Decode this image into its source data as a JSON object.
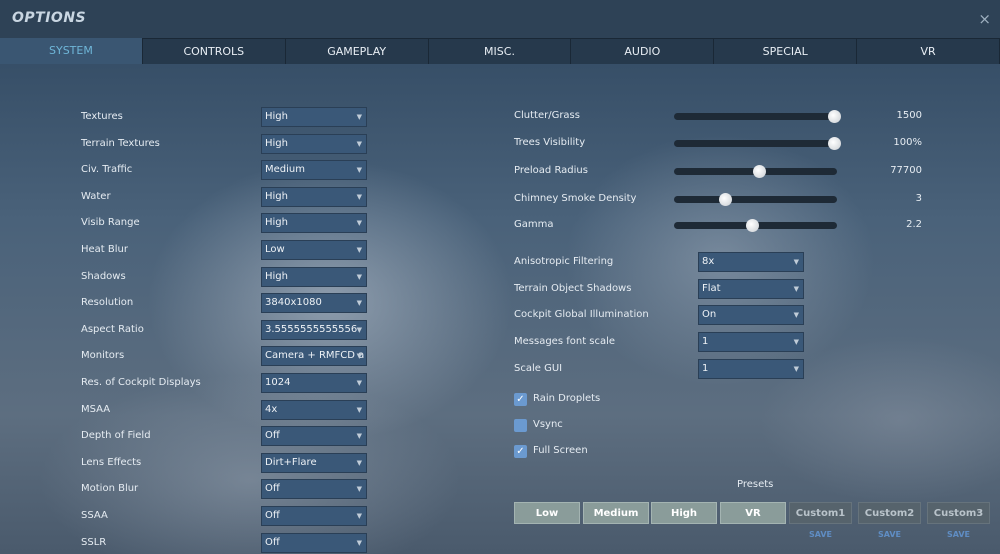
{
  "window": {
    "title": "OPTIONS",
    "close_icon": "×"
  },
  "tabs": [
    "SYSTEM",
    "CONTROLS",
    "GAMEPLAY",
    "MISC.",
    "AUDIO",
    "SPECIAL",
    "VR"
  ],
  "left_settings": [
    {
      "label": "Textures",
      "value": "High"
    },
    {
      "label": "Terrain Textures",
      "value": "High"
    },
    {
      "label": "Civ. Traffic",
      "value": "Medium"
    },
    {
      "label": "Water",
      "value": "High"
    },
    {
      "label": "Visib Range",
      "value": "High"
    },
    {
      "label": "Heat Blur",
      "value": "Low"
    },
    {
      "label": "Shadows",
      "value": "High"
    },
    {
      "label": "Resolution",
      "value": "3840x1080"
    },
    {
      "label": "Aspect Ratio",
      "value": "3.5555555555556"
    },
    {
      "label": "Monitors",
      "value": "Camera + RMFCD a"
    },
    {
      "label": "Res. of Cockpit Displays",
      "value": "1024"
    },
    {
      "label": "MSAA",
      "value": "4x"
    },
    {
      "label": "Depth of Field",
      "value": "Off"
    },
    {
      "label": "Lens Effects",
      "value": "Dirt+Flare"
    },
    {
      "label": "Motion Blur",
      "value": "Off"
    },
    {
      "label": "SSAA",
      "value": "Off"
    },
    {
      "label": "SSLR",
      "value": "Off"
    }
  ],
  "sliders": [
    {
      "label": "Clutter/Grass",
      "value": "1500",
      "fraction": 0.98
    },
    {
      "label": "Trees Visibility",
      "value": "100%",
      "fraction": 0.98
    },
    {
      "label": "Preload Radius",
      "value": "77700",
      "fraction": 0.52
    },
    {
      "label": "Chimney Smoke Density",
      "value": "3",
      "fraction": 0.31
    },
    {
      "label": "Gamma",
      "value": "2.2",
      "fraction": 0.48
    }
  ],
  "right_settings": [
    {
      "label": "Anisotropic Filtering",
      "value": "8x"
    },
    {
      "label": "Terrain Object Shadows",
      "value": "Flat"
    },
    {
      "label": "Cockpit Global Illumination",
      "value": "On"
    },
    {
      "label": "Messages font scale",
      "value": "1"
    },
    {
      "label": "Scale GUI",
      "value": "1"
    }
  ],
  "checkboxes": [
    {
      "label": "Rain Droplets",
      "checked": true
    },
    {
      "label": "Vsync",
      "checked": false
    },
    {
      "label": "Full Screen",
      "checked": true
    }
  ],
  "presets": {
    "title": "Presets",
    "standard": [
      "Low",
      "Medium",
      "High",
      "VR"
    ],
    "custom": [
      "Custom1",
      "Custom2",
      "Custom3"
    ],
    "save_label": "SAVE"
  }
}
